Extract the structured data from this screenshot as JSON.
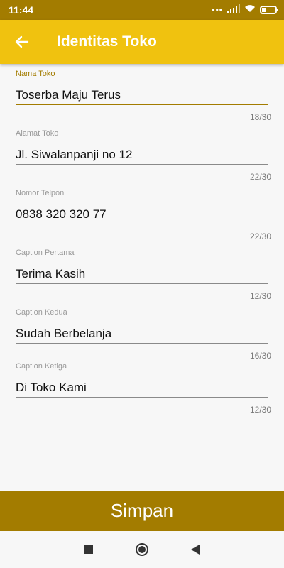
{
  "status_bar": {
    "time": "11:44",
    "dots": "•••",
    "icons": [
      "signal-icon",
      "wifi-icon",
      "battery-icon"
    ]
  },
  "app_bar": {
    "title": "Identitas Toko",
    "back_icon": "arrow-left-icon"
  },
  "form": {
    "fields": [
      {
        "label": "Nama Toko",
        "value": "Toserba Maju Terus",
        "counter": "18/30"
      },
      {
        "label": "Alamat Toko",
        "value": "Jl. Siwalanpanji no 12",
        "counter": "22/30"
      },
      {
        "label": "Nomor Telpon",
        "value": "0838 320 320 77",
        "counter": "22/30"
      },
      {
        "label": "Caption Pertama",
        "value": "Terima Kasih",
        "counter": "12/30"
      },
      {
        "label": "Caption Kedua",
        "value": "Sudah Berbelanja",
        "counter": "16/30"
      },
      {
        "label": "Caption Ketiga",
        "value": "Di Toko Kami",
        "counter": "12/30"
      }
    ]
  },
  "save_button": {
    "label": "Simpan"
  },
  "nav_bar": {
    "icons": [
      "recent-apps-icon",
      "home-icon",
      "back-icon"
    ]
  },
  "colors": {
    "accent": "#f0c20f",
    "accent_dark": "#a37c00",
    "background": "#f7f7f7"
  }
}
